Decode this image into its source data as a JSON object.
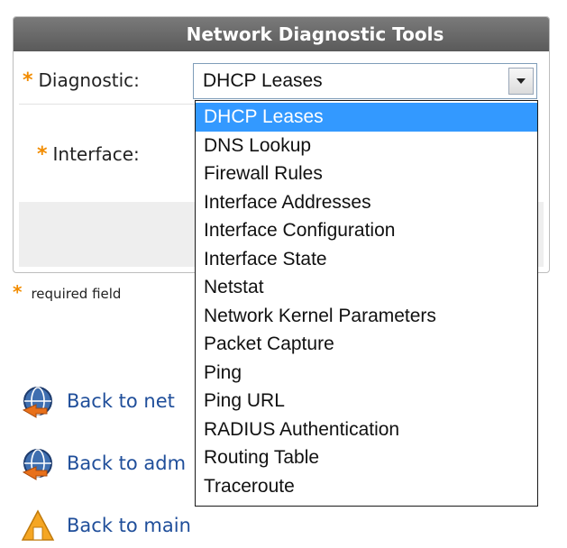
{
  "panel": {
    "title": "Network Diagnostic Tools",
    "diagnostic_label": "Diagnostic:",
    "interface_label": "Interface:",
    "required_marker": "*"
  },
  "select": {
    "current_value": "DHCP Leases",
    "options": [
      "DHCP Leases",
      "DNS Lookup",
      "Firewall Rules",
      "Interface Addresses",
      "Interface Configuration",
      "Interface State",
      "Netstat",
      "Network Kernel Parameters",
      "Packet Capture",
      "Ping",
      "Ping URL",
      "RADIUS Authentication",
      "Routing Table",
      "Traceroute"
    ]
  },
  "required_note": "required field",
  "links": {
    "back_network": "Back to net",
    "back_admin": "Back to adm",
    "back_main": "Back to main"
  },
  "colors": {
    "header": "#666666",
    "required": "#f28c00",
    "selection": "#3399ff",
    "link": "#1f4e9a"
  },
  "icons": {
    "back_network": "globe-back-icon",
    "back_admin": "globe-back-icon",
    "back_main": "home-back-icon"
  }
}
